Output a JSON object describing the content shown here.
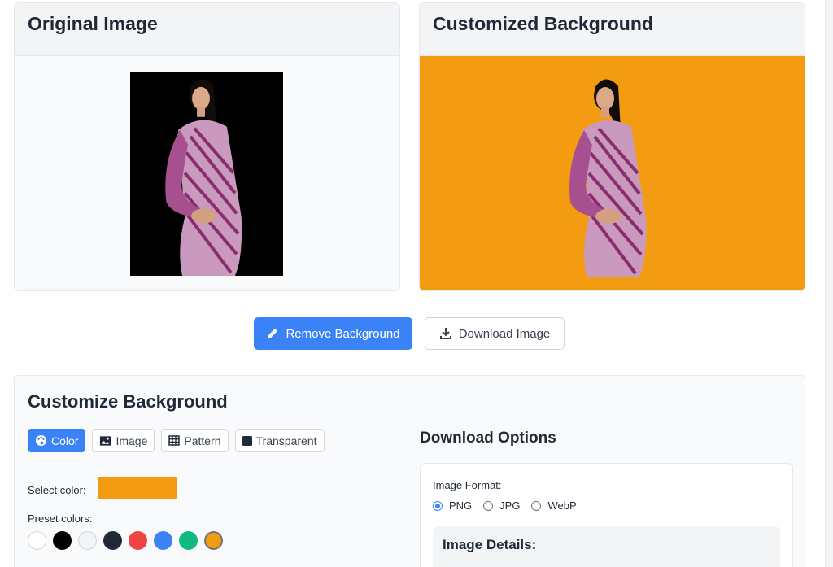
{
  "panels": {
    "original_title": "Original Image",
    "custom_title": "Customized Background"
  },
  "colors": {
    "accent": "#3b82f6",
    "background_selected": "#f39c11"
  },
  "actions": {
    "remove_label": "Remove Background",
    "remove_icon": "pencil-icon",
    "download_label": "Download Image",
    "download_icon": "download-icon"
  },
  "customize": {
    "title": "Customize Background",
    "tabs": [
      {
        "label": "Color",
        "icon": "palette-icon",
        "active": true
      },
      {
        "label": "Image",
        "icon": "image-icon",
        "active": false
      },
      {
        "label": "Pattern",
        "icon": "grid-icon",
        "active": false
      },
      {
        "label": "Transparent",
        "icon": "square-icon",
        "active": false
      }
    ],
    "select_color_label": "Select color:",
    "preset_label": "Preset colors:",
    "presets": [
      "#ffffff",
      "#000000",
      "#f3f4f6",
      "#1f2937",
      "#ef4444",
      "#3b82f6",
      "#10b981",
      "#f39c11"
    ]
  },
  "download_options": {
    "title": "Download Options",
    "format_label": "Image Format:",
    "formats": [
      {
        "label": "PNG",
        "checked": true
      },
      {
        "label": "JPG",
        "checked": false
      },
      {
        "label": "WebP",
        "checked": false
      }
    ],
    "details_title": "Image Details:"
  }
}
